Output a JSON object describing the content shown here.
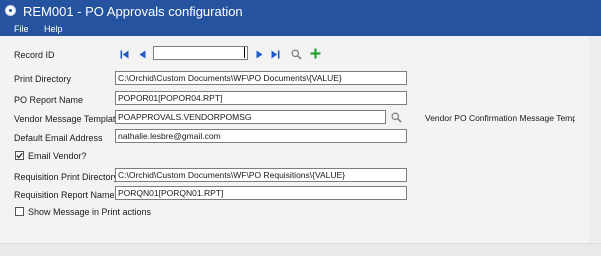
{
  "window": {
    "title": "REM001 - PO Approvals configuration"
  },
  "menu": {
    "items": [
      "File",
      "Help"
    ]
  },
  "record": {
    "label": "Record ID",
    "value": ""
  },
  "fields": {
    "print_directory": {
      "label": "Print Directory",
      "value": "C:\\Orchid\\Custom Documents\\WF\\PO Documents\\{VALUE}"
    },
    "po_report_name": {
      "label": "PO Report Name",
      "value": "POPOR01[POPOR04.RPT]"
    },
    "vendor_message_template": {
      "label": "Vendor Message Templat",
      "value": "POAPPROVALS.VENDORPOMSG"
    },
    "vendor_po_side_label": "Vendor PO Confirmation Message Template",
    "default_email": {
      "label": "Default Email Address",
      "value": "nathalie.lesbre@gmail.com"
    },
    "email_vendor": {
      "label": "Email Vendor?",
      "checked": true
    },
    "req_print_directory": {
      "label": "Requisition Print Directory",
      "value": "C:\\Orchid\\Custom Documents\\WF\\PO Requisitions\\{VALUE}"
    },
    "req_report_name": {
      "label": "Requisition Report Name",
      "value": "PORQN01[PORQN01.RPT]"
    },
    "show_message": {
      "label": "Show Message in Print actions",
      "checked": false
    }
  },
  "icons": [
    "app-icon",
    "first-record-icon",
    "prev-record-icon",
    "next-record-icon",
    "last-record-icon",
    "search-icon",
    "add-icon",
    "finder-icon",
    "checkmark-icon"
  ],
  "colors": {
    "titlebar": "#2553a0",
    "nav_blue": "#1e5bc6",
    "add_green": "#22a12f"
  }
}
